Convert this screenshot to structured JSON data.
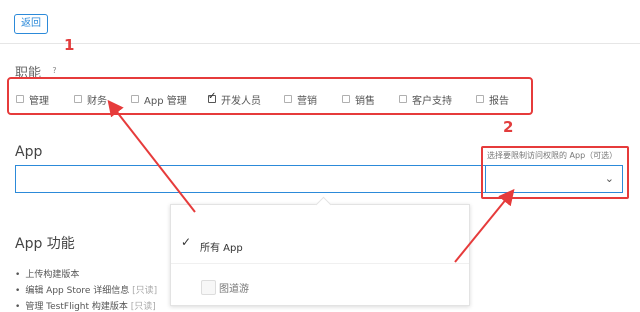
{
  "topbar": {
    "back_label": "返回"
  },
  "roles": {
    "label": "职能",
    "help": "?",
    "items": [
      {
        "label": "管理",
        "checked": false
      },
      {
        "label": "财务",
        "checked": false
      },
      {
        "label": "App 管理",
        "checked": false
      },
      {
        "label": "开发人员",
        "checked": true
      },
      {
        "label": "营销",
        "checked": false
      },
      {
        "label": "销售",
        "checked": false
      },
      {
        "label": "客户支持",
        "checked": false
      },
      {
        "label": "报告",
        "checked": false
      }
    ]
  },
  "annotations": {
    "one": "1",
    "two": "2"
  },
  "app_section": {
    "label": "App",
    "hint": "选择要限制访问权限的 App（可选）",
    "input_value": ""
  },
  "dropdown": {
    "all_apps_label": "所有 App",
    "app_item_label": "图道游"
  },
  "features": {
    "title": "App 功能",
    "items": [
      "上传构建版本",
      "编辑 App Store 详细信息",
      "管理 TestFlight 构建版本"
    ],
    "tag": "[只读]"
  },
  "colors": {
    "accent": "#2c8ad9",
    "annotation": "#e63b3b"
  }
}
